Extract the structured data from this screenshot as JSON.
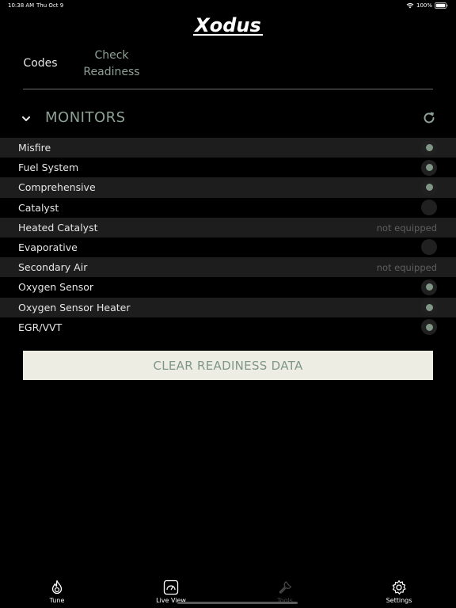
{
  "status_bar": {
    "time": "10:38 AM",
    "date": "Thu Oct 9",
    "battery": "100%"
  },
  "header": {
    "logo_text": "Xodus"
  },
  "tabs": [
    {
      "label": "Codes",
      "active": true
    },
    {
      "label_line1": "Check",
      "label_line2": "Readiness",
      "active": false
    }
  ],
  "monitors_section": {
    "title": "MONITORS"
  },
  "monitors": [
    {
      "label": "Misfire",
      "status": "complete",
      "status_text": ""
    },
    {
      "label": "Fuel System",
      "status": "complete",
      "status_text": ""
    },
    {
      "label": "Comprehensive",
      "status": "complete",
      "status_text": ""
    },
    {
      "label": "Catalyst",
      "status": "incomplete",
      "status_text": ""
    },
    {
      "label": "Heated Catalyst",
      "status": "not_equipped",
      "status_text": "not equipped"
    },
    {
      "label": "Evaporative",
      "status": "incomplete",
      "status_text": ""
    },
    {
      "label": "Secondary Air",
      "status": "not_equipped",
      "status_text": "not equipped"
    },
    {
      "label": "Oxygen Sensor",
      "status": "complete",
      "status_text": ""
    },
    {
      "label": "Oxygen Sensor Heater",
      "status": "complete",
      "status_text": ""
    },
    {
      "label": "EGR/VVT",
      "status": "complete",
      "status_text": ""
    }
  ],
  "clear_button": {
    "label": "CLEAR READINESS DATA"
  },
  "bottom_nav": [
    {
      "label": "Tune",
      "icon": "flame-icon",
      "active": false
    },
    {
      "label": "Live View",
      "icon": "gauge-icon",
      "active": false
    },
    {
      "label": "Tools",
      "icon": "wrench-icon",
      "active": true
    },
    {
      "label": "Settings",
      "icon": "gear-icon",
      "active": false
    }
  ],
  "colors": {
    "background": "#000000",
    "accent": "#8ea195",
    "status_dot": "#7f9686",
    "row_shade": "#1d1d1d",
    "button_bg": "#eeede4"
  }
}
